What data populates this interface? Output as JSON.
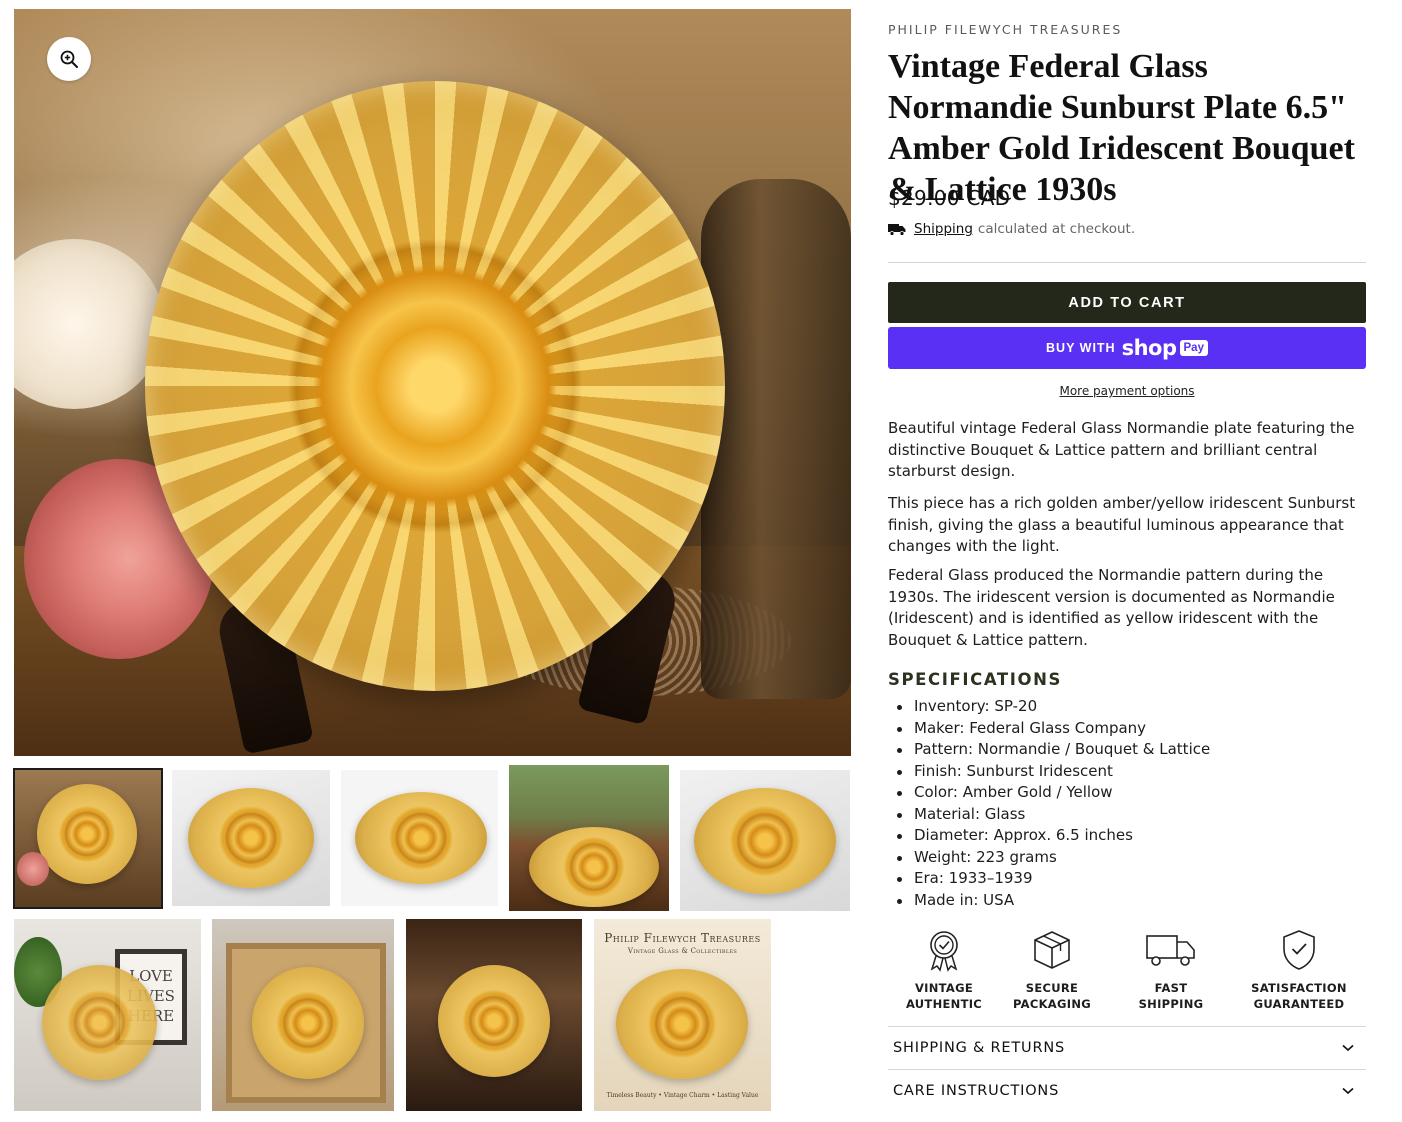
{
  "gallery": {
    "zoom_icon": "zoom-in-icon",
    "thumbnails": [
      {
        "alt": "styled amber plate on stand"
      },
      {
        "alt": "plate on white marble"
      },
      {
        "alt": "plate angled view"
      },
      {
        "alt": "plate on wooden table with plants"
      },
      {
        "alt": "plate close-up"
      },
      {
        "alt": "plate with sign",
        "sign_text": "LOVE LIVES HERE"
      },
      {
        "alt": "plate in gift box"
      },
      {
        "alt": "plate in cabinet"
      },
      {
        "alt": "branded card",
        "title": "Philip Filewych Treasures",
        "subtitle": "Vintage Glass & Collectibles",
        "footer": "Timeless Beauty • Vintage Charm • Lasting Value"
      }
    ]
  },
  "product": {
    "vendor": "PHILIP FILEWYCH TREASURES",
    "title": "Vintage Federal Glass Normandie Sunburst Plate 6.5\" Amber Gold Iridescent Bouquet & Lattice 1930s",
    "price": "$29.00 CAD",
    "shipping_link": "Shipping",
    "shipping_rest": "calculated at checkout.",
    "add_to_cart": "ADD TO CART",
    "buy_with": "BUY WITH",
    "shop_word": "shop",
    "pay_word": "Pay",
    "more_payment": "More payment options",
    "description": [
      "Beautiful vintage Federal Glass Normandie plate featuring the distinctive Bouquet & Lattice pattern and brilliant central starburst design.",
      "This piece has a rich golden amber/yellow iridescent Sunburst finish, giving the glass a beautiful luminous appearance that changes with the light.",
      "Federal Glass produced the Normandie pattern during the 1930s. The iridescent version is documented as Normandie (Iridescent) and is identified as yellow iridescent with the Bouquet & Lattice pattern."
    ],
    "specs_title": "SPECIFICATIONS",
    "specs": [
      "Inventory: SP-20",
      "Maker: Federal Glass Company",
      "Pattern: Normandie / Bouquet & Lattice",
      "Finish: Sunburst Iridescent",
      "Color: Amber Gold / Yellow",
      "Material: Glass",
      "Diameter: Approx. 6.5 inches",
      "Weight: 223 grams",
      "Era: 1933–1939",
      "Made in: USA"
    ],
    "badges": [
      {
        "icon": "award-ribbon-icon",
        "label": "VINTAGE\nAUTHENTIC"
      },
      {
        "icon": "package-box-icon",
        "label": "SECURE\nPACKAGING"
      },
      {
        "icon": "truck-icon",
        "label": "FAST\nSHIPPING"
      },
      {
        "icon": "shield-check-icon",
        "label": "SATISFACTION\nGUARANTEED"
      }
    ],
    "accordions": [
      {
        "label": "SHIPPING & RETURNS",
        "icon": "chevron-down-icon"
      },
      {
        "label": "CARE INSTRUCTIONS",
        "icon": "chevron-down-icon"
      }
    ]
  },
  "colors": {
    "cart_button": "#24281a",
    "shop_pay": "#5a31f4",
    "spec_heading": "#2c3220"
  }
}
